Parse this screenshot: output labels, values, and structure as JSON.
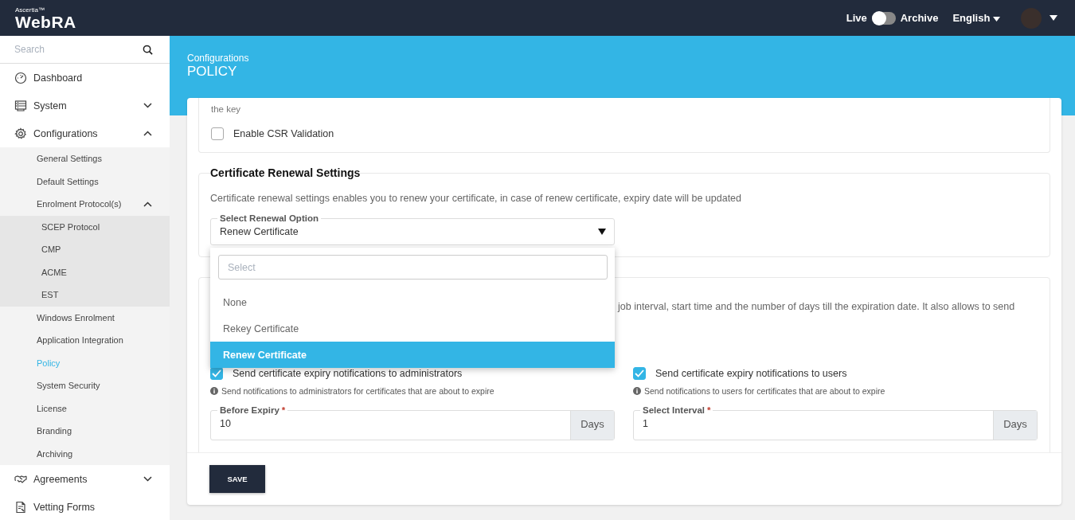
{
  "brand": {
    "small": "Ascertia™",
    "name": "WebRA"
  },
  "topbar": {
    "live_label": "Live",
    "archive_label": "Archive",
    "archive_on": false,
    "language": "English"
  },
  "sidebar": {
    "search_placeholder": "Search",
    "items": [
      {
        "label": "Dashboard",
        "selected": false
      },
      {
        "label": "System",
        "expanded": false,
        "selected": false
      },
      {
        "label": "Configurations",
        "expanded": true,
        "selected": false,
        "children": [
          {
            "label": "General Settings",
            "selected": false
          },
          {
            "label": "Default Settings",
            "selected": false
          },
          {
            "label": "Enrolment Protocol(s)",
            "selected": false,
            "expanded": true,
            "children": [
              {
                "label": "SCEP Protocol",
                "selected": false
              },
              {
                "label": "CMP",
                "selected": false
              },
              {
                "label": "ACME",
                "selected": false
              },
              {
                "label": "EST",
                "selected": false
              }
            ]
          },
          {
            "label": "Windows Enrolment",
            "selected": false
          },
          {
            "label": "Application Integration",
            "selected": false
          },
          {
            "label": "Policy",
            "selected": true
          },
          {
            "label": "System Security",
            "selected": false
          },
          {
            "label": "License",
            "selected": false
          },
          {
            "label": "Branding",
            "selected": false
          },
          {
            "label": "Archiving",
            "selected": false
          }
        ]
      },
      {
        "label": "Agreements",
        "expanded": false,
        "selected": false
      },
      {
        "label": "Vetting Forms",
        "selected": false
      }
    ]
  },
  "page": {
    "breadcrumb": "Configurations",
    "title": "POLICY"
  },
  "csr_section": {
    "text_tail": "the key",
    "checkbox": {
      "label": "Enable CSR Validation",
      "checked": false
    }
  },
  "renewal_section": {
    "title": "Certificate Renewal Settings",
    "description": "Certificate renewal settings enables you to renew your certificate, in case of renew certificate, expiry date will be updated",
    "select": {
      "label": "Select Renewal Option",
      "value": "Renew Certificate",
      "expanded": true,
      "search_placeholder": "Select",
      "options": [
        {
          "label": "None",
          "selected": false
        },
        {
          "label": "Rekey Certificate",
          "selected": false
        },
        {
          "label": "Renew Certificate",
          "selected": true
        }
      ]
    }
  },
  "expiry_section": {
    "description_visible": "job interval, start time and the number of days till the expiration date. It also allows to send",
    "columns": [
      {
        "checkbox": {
          "label": "Send certificate expiry notifications to administrators",
          "checked": true
        },
        "hint": "Send notifications to administrators for certificates that are about to expire",
        "field": {
          "label": "Before Expiry",
          "required_mark": "*",
          "value": "10",
          "unit": "Days"
        }
      },
      {
        "checkbox": {
          "label": "Send certificate expiry notifications to users",
          "checked": true
        },
        "hint": "Send notifications to users for certificates that are about to expire",
        "field": {
          "label": "Select Interval",
          "required_mark": "*",
          "value": "1",
          "unit": "Days"
        }
      }
    ]
  },
  "save_button": "SAVE"
}
